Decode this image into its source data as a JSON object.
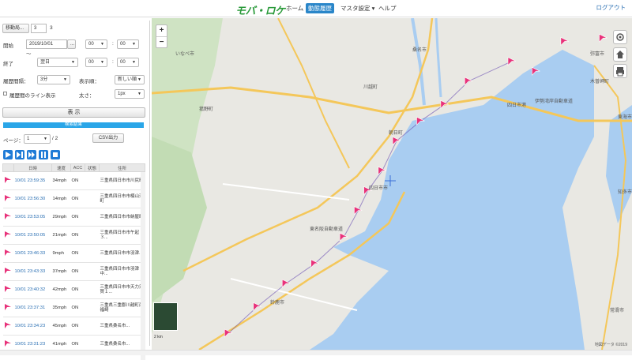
{
  "header": {
    "logo": "モバ・ロケ",
    "nav": [
      {
        "label": "ホーム",
        "active": false
      },
      {
        "label": "動態履歴",
        "active": true
      },
      {
        "label": "マスタ設定 ▾",
        "active": false
      },
      {
        "label": "ヘルプ",
        "active": false
      }
    ],
    "logout": "ログアウト"
  },
  "panel": {
    "vehicle_button": "移動局...",
    "vehicle_value": "3",
    "vehicle_count": "3",
    "start_label": "開始",
    "start_date": "2019/10/01",
    "start_date_btn": "...",
    "start_hour": "00",
    "start_min": "00",
    "tilde": "～",
    "end_label": "終了",
    "end_date": "翌日",
    "end_hour": "00",
    "end_min": "00",
    "interval_label": "履歴間隔：",
    "interval_value": "3分",
    "order_label": "表示順：",
    "order_value": "新しい順",
    "line_label": "履歴間のライン表示",
    "thickness_label": "太さ：",
    "thickness_value": "1px",
    "show_button": "表 示",
    "result_bar": "検索結果",
    "page_label": "ページ：",
    "page_value": "1",
    "page_total": "/ 2",
    "csv_button": "CSV出力",
    "columns": [
      "日時",
      "速度",
      "ACC",
      "状態",
      "住所"
    ],
    "rows": [
      {
        "date": "10/01 23:59:35",
        "speed": "34mph",
        "acc": "ON",
        "state": "",
        "place": "三重県四日市市川尻町"
      },
      {
        "date": "10/01 23:56:30",
        "speed": "14mph",
        "acc": "ON",
        "state": "",
        "place": "三重県四日市市楠山浦町"
      },
      {
        "date": "10/01 23:53:05",
        "speed": "29mph",
        "acc": "ON",
        "state": "",
        "place": "三重県四日市市納屋町"
      },
      {
        "date": "10/01 23:50:05",
        "speed": "21mph",
        "acc": "ON",
        "state": "",
        "place": "三重県四日市市午起３..."
      },
      {
        "date": "10/01 23:46:33",
        "speed": "9mph",
        "acc": "ON",
        "state": "",
        "place": "三重県四日市市羽津..."
      },
      {
        "date": "10/01 23:43:33",
        "speed": "37mph",
        "acc": "ON",
        "state": "",
        "place": "三重県四日市市羽津中..."
      },
      {
        "date": "10/01 23:40:32",
        "speed": "42mph",
        "acc": "ON",
        "state": "",
        "place": "三重県四日市市天力須賀１..."
      },
      {
        "date": "10/01 23:37:31",
        "speed": "35mph",
        "acc": "ON",
        "state": "",
        "place": "三重県三重郡川越町南福崎"
      },
      {
        "date": "10/01 23:34:23",
        "speed": "45mph",
        "acc": "ON",
        "state": "",
        "place": "三重県桑名市..."
      },
      {
        "date": "10/01 23:31:23",
        "speed": "41mph",
        "acc": "ON",
        "state": "",
        "place": "三重県桑名市..."
      }
    ]
  },
  "map": {
    "labels": [
      {
        "t": "桑名市"
      },
      {
        "t": "弥富市"
      },
      {
        "t": "木曽岬町"
      },
      {
        "t": "川越町"
      },
      {
        "t": "朝日町"
      },
      {
        "t": "四日市市"
      },
      {
        "t": "菰野町"
      },
      {
        "t": "鈴鹿市"
      },
      {
        "t": "知多市"
      },
      {
        "t": "常滑市"
      },
      {
        "t": "東海市"
      },
      {
        "t": "いなべ市"
      },
      {
        "t": "四日市港"
      },
      {
        "t": "伊勢湾岸自動車道"
      },
      {
        "t": "東名阪自動車道"
      }
    ],
    "attribution": "地図データ ©2019",
    "scale_text": "2 km",
    "markers": [
      {
        "fx": 0.75,
        "fy": 0.13
      },
      {
        "fx": 0.66,
        "fy": 0.19
      },
      {
        "fx": 0.61,
        "fy": 0.26
      },
      {
        "fx": 0.56,
        "fy": 0.31
      },
      {
        "fx": 0.51,
        "fy": 0.37
      },
      {
        "fx": 0.48,
        "fy": 0.46
      },
      {
        "fx": 0.45,
        "fy": 0.52
      },
      {
        "fx": 0.43,
        "fy": 0.58
      },
      {
        "fx": 0.4,
        "fy": 0.66
      },
      {
        "fx": 0.34,
        "fy": 0.74
      },
      {
        "fx": 0.28,
        "fy": 0.8
      },
      {
        "fx": 0.22,
        "fy": 0.87
      },
      {
        "fx": 0.16,
        "fy": 0.95
      },
      {
        "fx": 0.86,
        "fy": 0.07
      },
      {
        "fx": 0.94,
        "fy": 0.06
      },
      {
        "fx": 0.8,
        "fy": 0.16
      }
    ]
  },
  "colors": {
    "accent": "#2a86c9",
    "result": "#2aa6e8",
    "water": "#a9cdf1",
    "marker": "#e8327a",
    "land": "#e9e8e3"
  }
}
